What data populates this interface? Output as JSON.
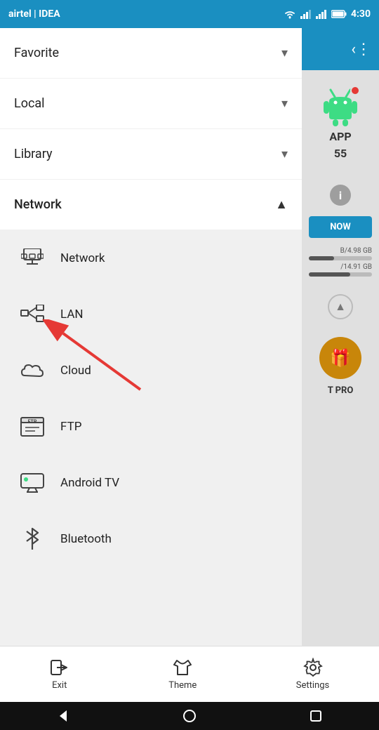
{
  "statusBar": {
    "carrier": "airtel | IDEA",
    "time": "4:30"
  },
  "drawer": {
    "menuItems": [
      {
        "id": "favorite",
        "label": "Favorite",
        "chevron": "▾",
        "expanded": false
      },
      {
        "id": "local",
        "label": "Local",
        "chevron": "▾",
        "expanded": false
      },
      {
        "id": "library",
        "label": "Library",
        "chevron": "▾",
        "expanded": false
      },
      {
        "id": "network",
        "label": "Network",
        "chevron": "▲",
        "expanded": true
      }
    ],
    "networkSubmenu": [
      {
        "id": "network-item",
        "label": "Network",
        "icon": "network-icon"
      },
      {
        "id": "lan-item",
        "label": "LAN",
        "icon": "lan-icon"
      },
      {
        "id": "cloud-item",
        "label": "Cloud",
        "icon": "cloud-icon"
      },
      {
        "id": "ftp-item",
        "label": "FTP",
        "icon": "ftp-icon"
      },
      {
        "id": "androidtv-item",
        "label": "Android TV",
        "icon": "tv-icon"
      },
      {
        "id": "bluetooth-item",
        "label": "Bluetooth",
        "icon": "bluetooth-icon"
      }
    ]
  },
  "rightPanel": {
    "appLabel": "APP",
    "appNumber": "55",
    "nowButton": "NOW",
    "storageText1": "B/4.98 GB",
    "storageText2": "/14.91 GB",
    "proText": "T PRO"
  },
  "bottomNav": [
    {
      "id": "exit",
      "label": "Exit",
      "icon": "exit-icon"
    },
    {
      "id": "theme",
      "label": "Theme",
      "icon": "theme-icon"
    },
    {
      "id": "settings",
      "label": "Settings",
      "icon": "settings-icon"
    }
  ],
  "colors": {
    "blue": "#1a8fc1",
    "green": "#3ddc84",
    "red": "#e53935",
    "orange": "#c8860a",
    "bgGray": "#f0f0f0"
  }
}
